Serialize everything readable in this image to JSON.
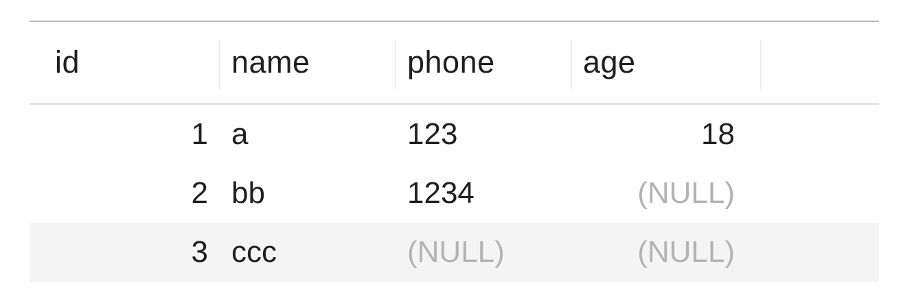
{
  "table": {
    "columns": [
      {
        "key": "id",
        "label": "id"
      },
      {
        "key": "name",
        "label": "name"
      },
      {
        "key": "phone",
        "label": "phone"
      },
      {
        "key": "age",
        "label": "age"
      }
    ],
    "rows": [
      {
        "id": "1",
        "name": "a",
        "phone": "123",
        "age": "18"
      },
      {
        "id": "2",
        "name": "bb",
        "phone": "1234",
        "age": "(NULL)"
      },
      {
        "id": "3",
        "name": "ccc",
        "phone": "(NULL)",
        "age": "(NULL)"
      }
    ],
    "selected_row": 2
  },
  "colors": {
    "text": "#1f1f1f",
    "null_text": "#b3b3b3",
    "selected_row_bg": "#f4f4f4",
    "rule": "#b8b8b8"
  }
}
